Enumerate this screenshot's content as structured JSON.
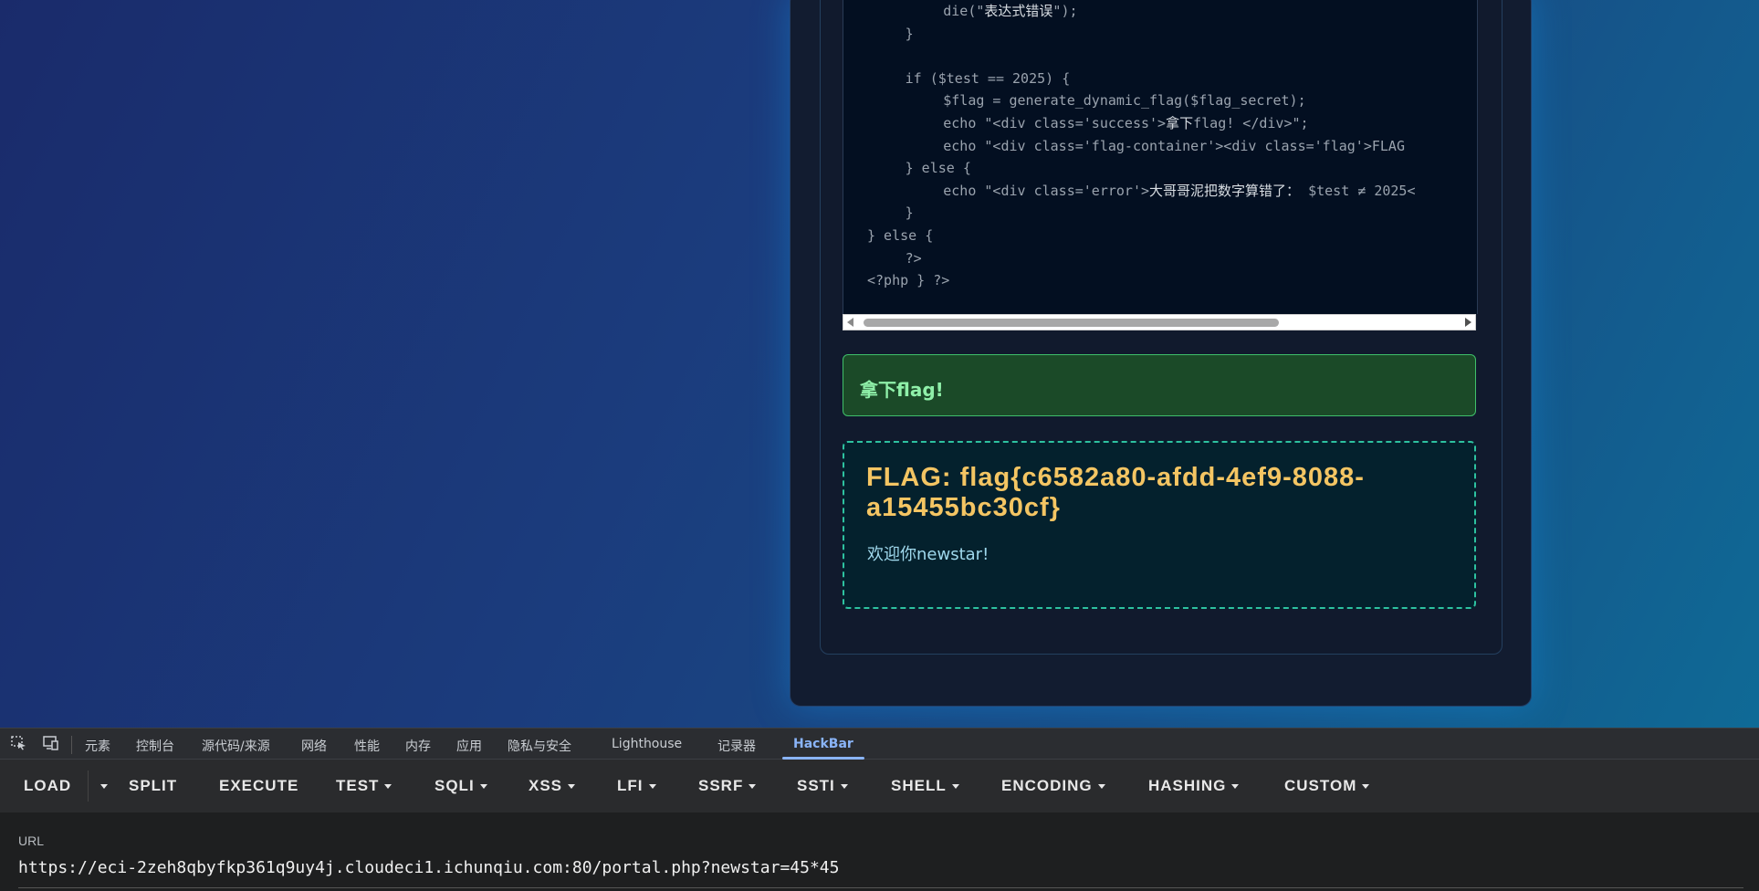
{
  "page": {
    "code_lines": [
      {
        "indent": 8,
        "before": "die(\"",
        "cjk": "表达式错误",
        "after": "\");"
      },
      {
        "indent": 4,
        "before": "}",
        "cjk": "",
        "after": ""
      },
      {
        "indent": 0,
        "before": "",
        "cjk": "",
        "after": ""
      },
      {
        "indent": 4,
        "before": "if ($test == 2025) {",
        "cjk": "",
        "after": ""
      },
      {
        "indent": 8,
        "before": "$flag = generate_dynamic_flag($flag_secret);",
        "cjk": "",
        "after": ""
      },
      {
        "indent": 8,
        "before": "echo \"<div class='success'>",
        "cjk": "拿下",
        "after": "flag! </div>\";"
      },
      {
        "indent": 8,
        "before": "echo \"<div class='flag-container'><div class='flag'>FLAG",
        "cjk": "",
        "after": ""
      },
      {
        "indent": 4,
        "before": "} else {",
        "cjk": "",
        "after": ""
      },
      {
        "indent": 8,
        "before": "echo \"<div class='error'>",
        "cjk": "大哥哥泥把数字算错了：",
        "after": " $test ≠ 2025<"
      },
      {
        "indent": 4,
        "before": "}",
        "cjk": "",
        "after": ""
      },
      {
        "indent": 0,
        "before": "} else {",
        "cjk": "",
        "after": ""
      },
      {
        "indent": 4,
        "before": "?>",
        "cjk": "",
        "after": ""
      },
      {
        "indent": 0,
        "before": "<?php } ?>",
        "cjk": "",
        "after": ""
      }
    ],
    "success_message": "拿下flag!",
    "flag_text": "FLAG: flag{c6582a80-afdd-4ef9-8088-a15455bc30cf}",
    "welcome_text": "欢迎你newstar!",
    "scrollbar": {
      "thumb_fraction": 0.7
    }
  },
  "devtools": {
    "tabs": [
      "元素",
      "控制台",
      "源代码/来源",
      "网络",
      "性能",
      "内存",
      "应用",
      "隐私与安全",
      "Lighthouse",
      "记录器",
      "HackBar"
    ],
    "active_tab": "HackBar",
    "icons": [
      "inspect-element-icon",
      "device-toolbar-icon"
    ]
  },
  "hackbar": {
    "buttons": [
      "LOAD",
      "SPLIT",
      "EXECUTE",
      "TEST",
      "SQLI",
      "XSS",
      "LFI",
      "SSRF",
      "SSTI",
      "SHELL",
      "ENCODING",
      "HASHING",
      "CUSTOM"
    ],
    "url_label": "URL",
    "url_value": "https://eci-2zeh8qbyfkp361q9uy4j.cloudeci1.ichunqiu.com:80/portal.php?newstar=45*45"
  }
}
